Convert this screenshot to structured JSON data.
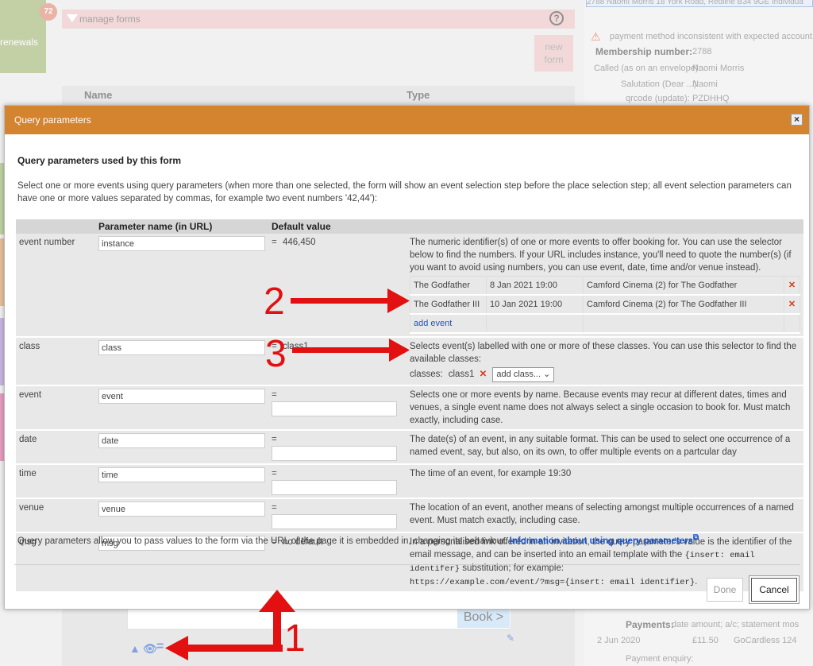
{
  "background": {
    "badge": "72",
    "renewals_label": "renewals",
    "manage_forms": "manage forms",
    "new_form": "new form",
    "col_name": "Name",
    "col_type": "Type",
    "book_label": "Book >",
    "right_panel": {
      "top_row": "2788     Naomi Morris     18 York Road, Redline B34 9GE     Individua",
      "warning": "payment method inconsistent with expected account",
      "membership_label": "Membership number:",
      "membership_value": "2788",
      "called_label": "Called (as on an envelope):",
      "called_value": "Naomi Morris",
      "salutation_label": "Salutation (Dear ...):",
      "salutation_value": "Naomi",
      "qrcode_label": "qrcode (update):",
      "qrcode_value": "PZDHHQ",
      "payments_label": "Payments:",
      "payments_cols": "date   amount; a/c; statement     mos",
      "payment_date": "2 Jun 2020",
      "payment_amount": "£11.50",
      "payment_account": "GoCardless 124",
      "payment_enquiry": "Payment enquiry:"
    }
  },
  "dialog": {
    "title": "Query parameters",
    "close": "×",
    "heading": "Query parameters used by this form",
    "intro": "Select one or more events using query parameters (when more than one selected, the form will show an event selection step before the place selection step; all event selection parameters can have one or more values separated by commas, for example two event numbers '42,44'):",
    "headers": {
      "param": "Parameter name (in URL)",
      "default": "Default value"
    },
    "rows": {
      "event_number": {
        "label": "event number",
        "param": "instance",
        "default": "446,450",
        "desc": "The numeric identifier(s) of one or more events to offer booking for. You can use the selector below to find the numbers. If your URL includes instance, you'll need to quote the number(s) (if you want to avoid using numbers, you can use event, date, time and/or venue instead).",
        "events": [
          {
            "name": "The Godfather",
            "date": "8 Jan 2021 19:00",
            "venue": "Camford Cinema (2) for The Godfather"
          },
          {
            "name": "The Godfather III",
            "date": "10 Jan 2021 19:00",
            "venue": "Camford Cinema (2) for The Godfather III"
          }
        ],
        "add_event": "add event"
      },
      "class": {
        "label": "class",
        "param": "class",
        "default": "class1",
        "desc": "Selects event(s) labelled with one or more of these classes. You can use this selector to find the available classes:",
        "classes_label": "classes:",
        "class_chip": "class1",
        "add_class": "add class..."
      },
      "event": {
        "label": "event",
        "param": "event",
        "desc": "Selects one or more events by name. Because events may recur at different dates, times and venues, a single event name does not always select a single occasion to book for. Must match exactly, including case."
      },
      "date": {
        "label": "date",
        "param": "date",
        "desc": "The date(s) of an event, in any suitable format. This can be used to select one occurrence of a named event, say, but also, on its own, to offer multiple events on a partcular day"
      },
      "time": {
        "label": "time",
        "param": "time",
        "desc": "The time of an event, for example 19:30"
      },
      "venue": {
        "label": "venue",
        "param": "venue",
        "desc": "The location of an event, another means of selecting amongst multiple occurrences of a named event. Must match exactly, including case."
      },
      "msg": {
        "label": "msg",
        "param": "msg",
        "default": "no default",
        "desc1": "In a personalised link offered in an invitation, the query parameter's value is the identifier of the email message, and can be inserted into an email template with the",
        "code1": "{insert: email identifer}",
        "desc2": "substitution; for example:",
        "code2": "https://example.com/event/?msg={insert: email identifier}",
        "desc3": "."
      }
    },
    "footnote": "Query parameters allow you to pass values to the form via the URL of the page it is embedded in, changing its behaviour.",
    "info_link": "Information about using query parameters",
    "done": "Done",
    "cancel": "Cancel"
  },
  "annotations": {
    "n1": "1",
    "n2": "2",
    "n3": "3"
  },
  "colors": {
    "title_bar": "#d4832f",
    "arrow": "#e21010",
    "link": "#1a56c8"
  }
}
